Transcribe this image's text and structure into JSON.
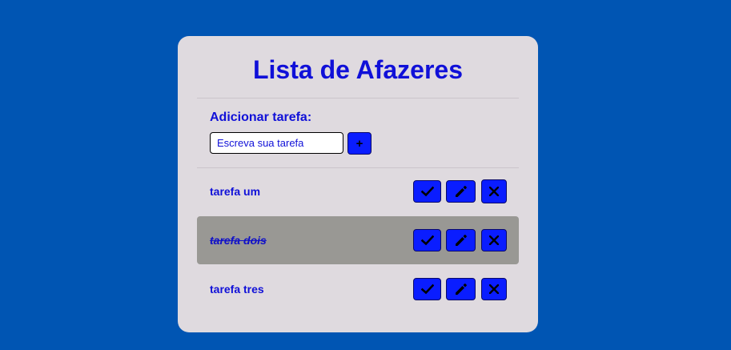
{
  "app": {
    "title": "Lista de Afazeres"
  },
  "add_form": {
    "label": "Adicionar tarefa:",
    "input_placeholder": "Escreva sua tarefa",
    "input_value": "",
    "add_button_label": "+"
  },
  "tasks": [
    {
      "text": "tarefa um",
      "done": false
    },
    {
      "text": "tarefa dois",
      "done": true
    },
    {
      "text": "tarefa tres",
      "done": false
    }
  ],
  "icons": {
    "done": "check-icon",
    "edit": "pencil-icon",
    "remove": "x-mark-icon"
  },
  "colors": {
    "page_background": "#0055b3",
    "card_background": "#dfdadf",
    "accent_text": "#1010d8",
    "button_background": "#0a1dff",
    "done_row_background": "#999894"
  }
}
